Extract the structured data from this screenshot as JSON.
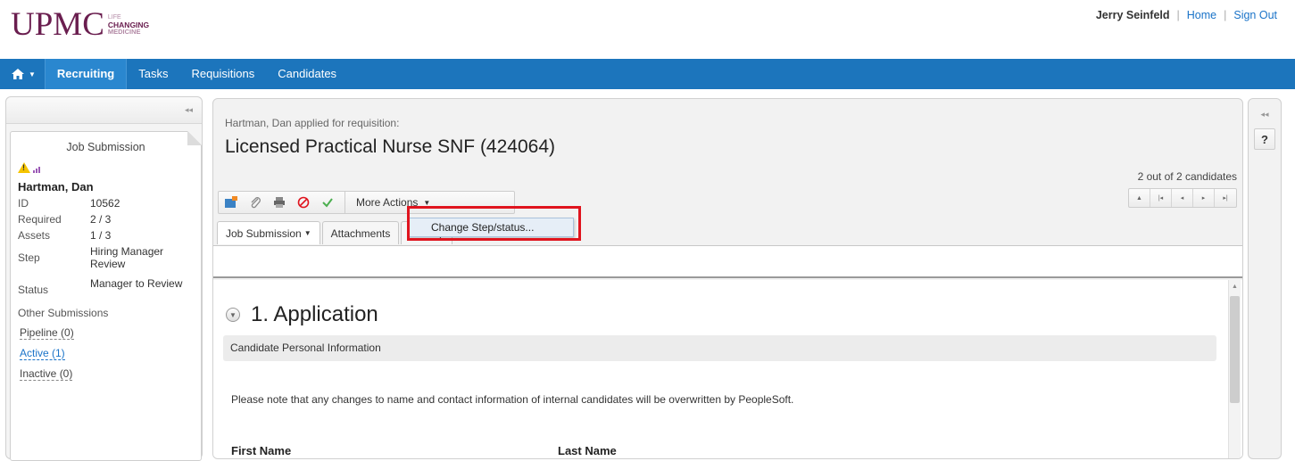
{
  "brand": {
    "name": "UPMC",
    "tag_line1": "LIFE",
    "tag_line2": "CHANGING",
    "tag_line3": "MEDICINE",
    "color": "#6a1e4f"
  },
  "user": {
    "name": "Jerry Seinfeld",
    "home": "Home",
    "signout": "Sign Out"
  },
  "nav": {
    "items": [
      "Recruiting",
      "Tasks",
      "Requisitions",
      "Candidates"
    ],
    "color": "#1c75bc"
  },
  "left": {
    "card_title": "Job Submission",
    "name": "Hartman, Dan",
    "fields": [
      {
        "k": "ID",
        "v": "10562"
      },
      {
        "k": "Required",
        "v": "2 / 3"
      },
      {
        "k": "Assets",
        "v": "1 / 3"
      },
      {
        "k": "Step",
        "v": "Hiring Manager Review"
      },
      {
        "k": "Status",
        "v": "Manager to Review"
      }
    ],
    "other_label": "Other Submissions",
    "links": [
      "Pipeline (0)",
      "Active (1)",
      "Inactive (0)"
    ]
  },
  "main": {
    "applied": "Hartman, Dan applied for requisition:",
    "title": "Licensed Practical Nurse SNF (424064)",
    "count": "2 out of 2 candidates",
    "more_actions": "More Actions",
    "menu_item": "Change Step/status...",
    "tabs": [
      "Job Submission",
      "Attachments",
      "History"
    ],
    "section_title": "1. Application",
    "subsection": "Candidate Personal Information",
    "notice": "Please note that any changes to name and contact information of internal candidates will be overwritten by PeopleSoft.",
    "first_name": "First Name",
    "last_name": "Last Name"
  },
  "right": {
    "help": "?"
  },
  "colors": {
    "highlight": "#e0141e",
    "link": "#1a73c8"
  }
}
